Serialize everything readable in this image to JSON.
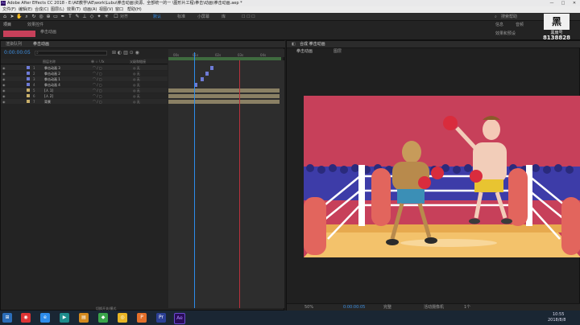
{
  "window": {
    "title": "Adobe After Effects CC 2018 - E:\\AE教学\\AE\\work\\Lubu\\拳击动画\\资源、全部统一的一 \\图形片工程\\拳击\\动画\\拳击动画.aep *",
    "minimize": "—",
    "maximize": "□",
    "close": "✕"
  },
  "menu": [
    "文件(F)",
    "编辑(E)",
    "合成(C)",
    "图层(L)",
    "效果(T)",
    "动画(A)",
    "视图(V)",
    "窗口",
    "帮助(H)"
  ],
  "toolbar": {
    "snap_label": "对齐",
    "workspace_label": "默认",
    "workspace_items": [
      "标准",
      "小屏幕",
      "库"
    ],
    "search_placeholder": "搜索帮助"
  },
  "project": {
    "tab": "项目",
    "subtab": "效果控件",
    "comp_label": "拳击动画"
  },
  "timeline": {
    "tabs": [
      "渲染队列",
      "拳击动画"
    ],
    "timecode": "0:00:00:05",
    "search_placeholder": "",
    "columns": [
      "图层名称",
      "单 ☆ \\ fx",
      "父级和链接"
    ],
    "layers": [
      {
        "num": "1",
        "name": "拳击动画 3",
        "color": "#6e7bd6",
        "parent": "无"
      },
      {
        "num": "2",
        "name": "拳击动画 2",
        "color": "#6e7bd6",
        "parent": "无"
      },
      {
        "num": "3",
        "name": "拳击动画 1",
        "color": "#6e7bd6",
        "parent": "无"
      },
      {
        "num": "4",
        "name": "拳击动画 4",
        "color": "#6e7bd6",
        "parent": "无"
      },
      {
        "num": "5",
        "name": "[人 1]",
        "color": "#c9b06a",
        "parent": "无"
      },
      {
        "num": "6",
        "name": "[人 2]",
        "color": "#c9b06a",
        "parent": "无"
      },
      {
        "num": "7",
        "name": "背景",
        "color": "#c9b06a",
        "parent": "无"
      }
    ],
    "ruler_labels": [
      "00s",
      "01s",
      "02s",
      "03s",
      "04s"
    ],
    "footer": "切换开关/模式"
  },
  "viewer": {
    "tab_label": "合成 拳击动画",
    "breadcrumb": "拳击动画",
    "sub_breadcrumb": "图层",
    "zoom": "50%",
    "timecode": "0:00:00:05",
    "resolution": "完整",
    "camera": "活动摄像机",
    "views": "1个"
  },
  "right_panel": {
    "info_label": "信息",
    "audio_label": "音频",
    "preview_label": "效果和预设"
  },
  "watermark": {
    "brand_top": "黑",
    "brand_text": "黑扇号",
    "code": "8138828"
  },
  "taskbar": {
    "icons": [
      "windows-start",
      "browser",
      "folder",
      "media",
      "app",
      "office",
      "chrome",
      "after-effects",
      "premiere"
    ],
    "time": "10:55",
    "date": "2018/8/8"
  },
  "colors": {
    "accent": "#2d8ceb",
    "canvas_bg": "#c7405a",
    "ring_floor": "#f3c26b",
    "corner_post": "#e2655d"
  }
}
